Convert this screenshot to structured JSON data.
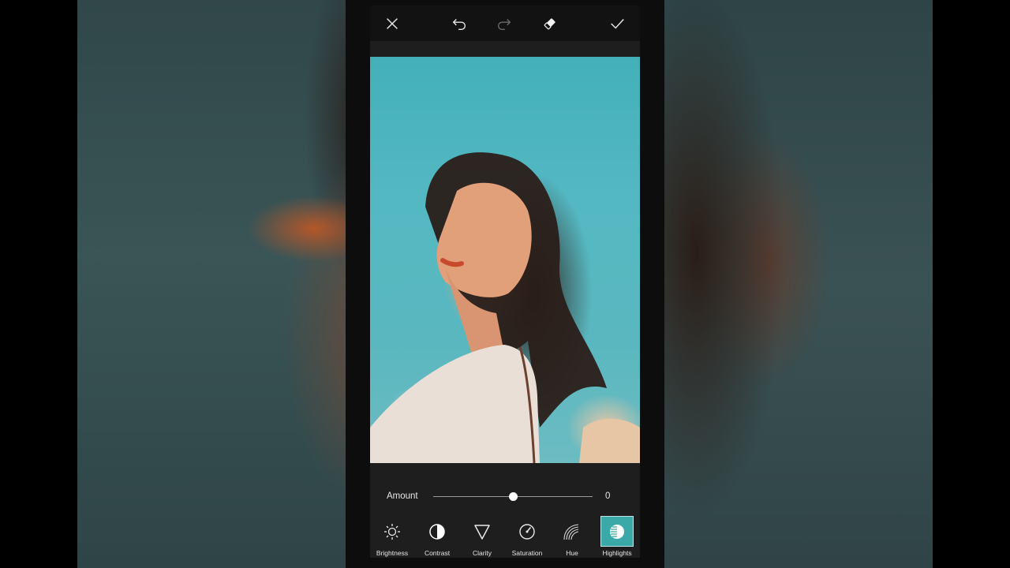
{
  "colors": {
    "accent": "#3ba9a8",
    "panel": "#1e1e1e",
    "topbar": "#121212"
  },
  "toolbar": {
    "close_icon": "close-icon",
    "undo_icon": "undo-icon",
    "redo_icon": "redo-icon",
    "eraser_icon": "eraser-icon",
    "apply_icon": "checkmark-icon"
  },
  "adjust": {
    "label": "Amount",
    "value": "0",
    "slider_fraction": 0.5
  },
  "tools": [
    {
      "label": "Brightness",
      "icon": "sun-icon"
    },
    {
      "label": "Contrast",
      "icon": "contrast-icon"
    },
    {
      "label": "Clarity",
      "icon": "triangle-icon"
    },
    {
      "label": "Saturation",
      "icon": "gauge-icon"
    },
    {
      "label": "Hue",
      "icon": "rainbow-icon"
    },
    {
      "label": "Highlights",
      "icon": "highlights-icon",
      "active": true
    }
  ]
}
